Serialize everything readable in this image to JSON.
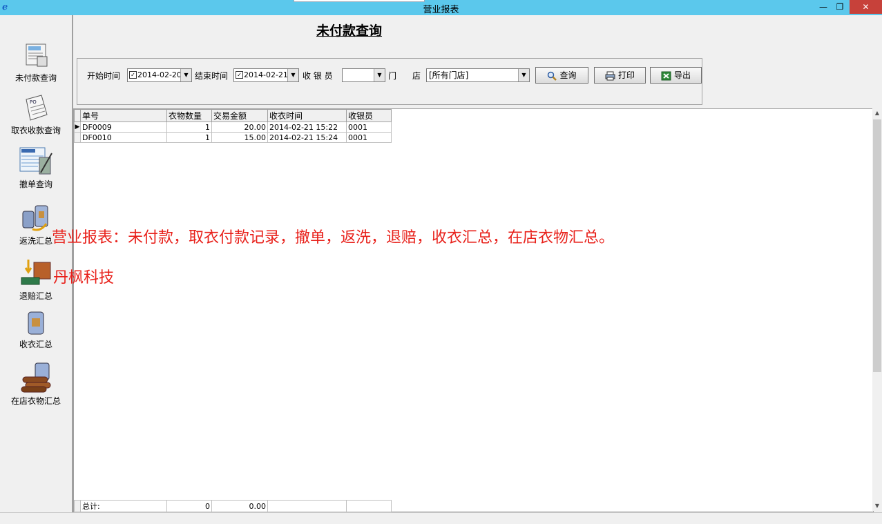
{
  "window": {
    "title": "营业报表",
    "minimize": "—",
    "maximize": "❐",
    "close": "✕"
  },
  "sidebar": {
    "items": [
      {
        "label": "未付款查询"
      },
      {
        "label": "取衣收款查询"
      },
      {
        "label": "撤单查询"
      },
      {
        "label": "返洗汇总"
      },
      {
        "label": "退赔汇总"
      },
      {
        "label": "收衣汇总"
      },
      {
        "label": "在店衣物汇总"
      }
    ]
  },
  "page": {
    "title": "未付款查询"
  },
  "filters": {
    "start_label": "开始时间",
    "start_value": "2014-02-20",
    "end_label": "结束时间",
    "end_value": "2014-02-21",
    "cashier_label": "收 银 员",
    "cashier_value": "",
    "store_label_a": "门",
    "store_label_b": "店",
    "store_value": "[所有门店]",
    "query_button": "查询",
    "print_button": "打印",
    "export_button": "导出"
  },
  "table": {
    "columns": [
      "单号",
      "衣物数量",
      "交易金额",
      "收衣时间",
      "收银员"
    ],
    "rows": [
      [
        "DF0009",
        "1",
        "20.00",
        "2014-02-21 15:22",
        "0001"
      ],
      [
        "DF0010",
        "1",
        "15.00",
        "2014-02-21 15:24",
        "0001"
      ]
    ],
    "totals": {
      "label": "总计:",
      "quantity": "0",
      "amount": "0.00"
    }
  },
  "overlay": {
    "line1": "营业报表：未付款，取衣付款记录，撤单，返洗，退赔，收衣汇总，在店衣物汇总。",
    "line2": "丹枫科技"
  }
}
